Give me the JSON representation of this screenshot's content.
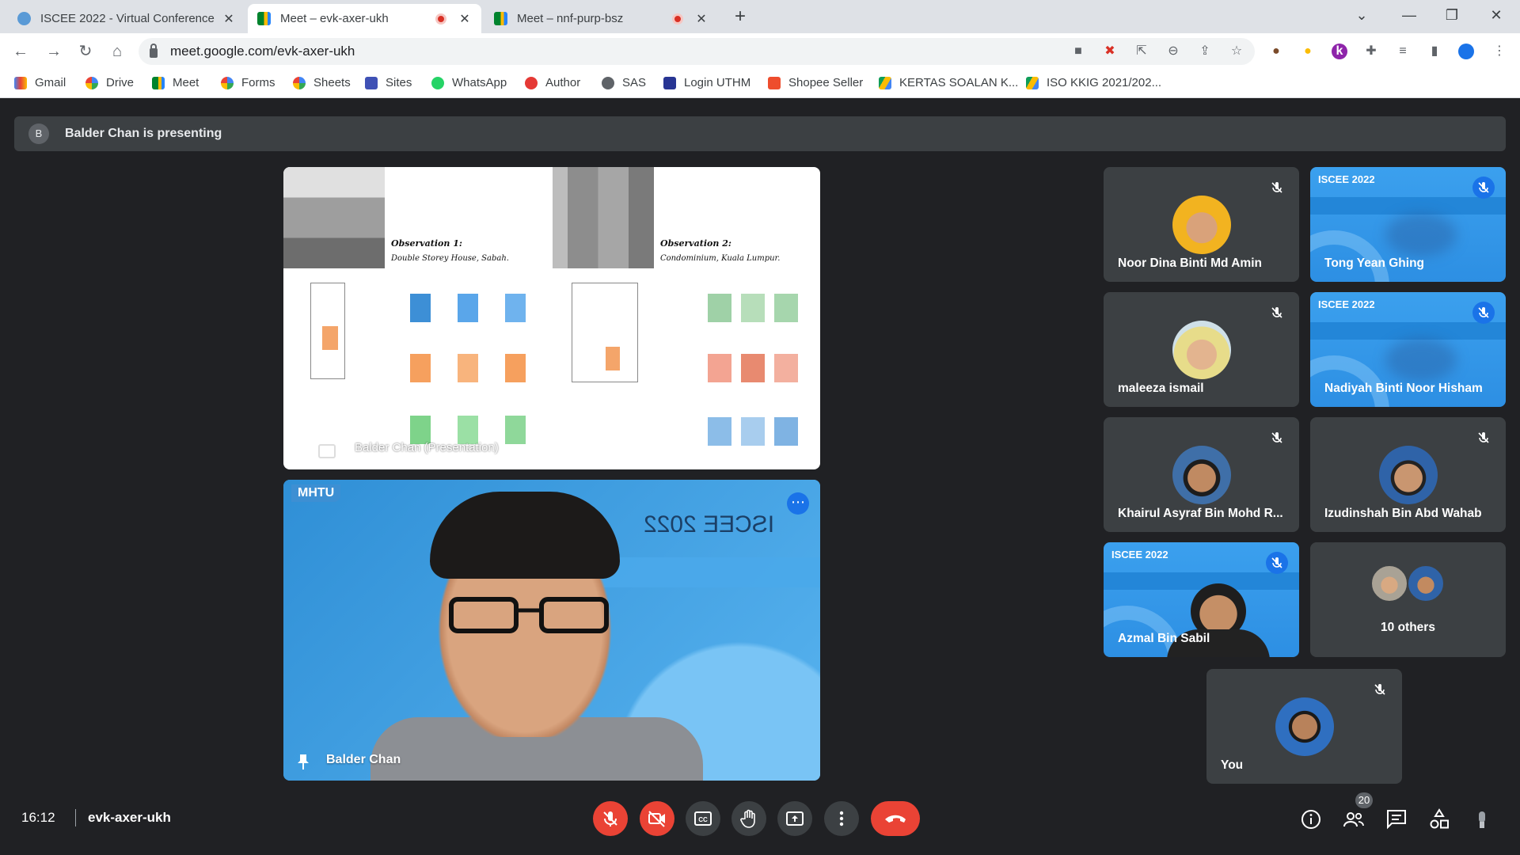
{
  "browser": {
    "tabs": [
      {
        "title": "ISCEE 2022 - Virtual Conference",
        "active": false
      },
      {
        "title": "Meet – evk-axer-ukh",
        "active": true,
        "recording": true
      },
      {
        "title": "Meet – nnf-purp-bsz",
        "active": false,
        "recording": true
      }
    ],
    "url": "meet.google.com/evk-axer-ukh",
    "bookmarks": [
      {
        "label": "Gmail",
        "icon": "gmail-icon"
      },
      {
        "label": "Drive",
        "icon": "google-icon"
      },
      {
        "label": "Meet",
        "icon": "meet-icon"
      },
      {
        "label": "Forms",
        "icon": "google-icon"
      },
      {
        "label": "Sheets",
        "icon": "google-icon"
      },
      {
        "label": "Sites",
        "icon": "sites-icon"
      },
      {
        "label": "WhatsApp",
        "icon": "whatsapp-icon"
      },
      {
        "label": "Author",
        "icon": "author-icon"
      },
      {
        "label": "SAS",
        "icon": "globe-icon"
      },
      {
        "label": "Login UTHM",
        "icon": "shield-icon"
      },
      {
        "label": "Shopee Seller",
        "icon": "shopee-icon"
      },
      {
        "label": "KERTAS SOALAN K...",
        "icon": "drive-icon"
      },
      {
        "label": "ISO KKIG 2021/202...",
        "icon": "drive-icon"
      }
    ]
  },
  "meet": {
    "presenting_banner": {
      "avatar_letter": "B",
      "text": "Balder Chan is presenting"
    },
    "presentation": {
      "label": "Balder Chan (Presentation)",
      "observation1_title": "Observation 1:",
      "observation1_sub": "Double Storey House, Sabah.",
      "observation2_title": "Observation 2:",
      "observation2_sub": "Condominium, Kuala Lumpur."
    },
    "speaker": {
      "name": "Balder Chan",
      "logo": "MHTU",
      "banner": "ISCEE 2022"
    },
    "participants": [
      {
        "name": "Noor Dina Binti Md Amin",
        "muted": true,
        "style": "avatar"
      },
      {
        "name": "Tong Yean Ghing",
        "muted": true,
        "style": "video"
      },
      {
        "name": "maleeza ismail",
        "muted": true,
        "style": "avatar"
      },
      {
        "name": "Nadiyah Binti Noor Hisham",
        "muted": true,
        "style": "video"
      },
      {
        "name": "Khairul Asyraf Bin Mohd R...",
        "muted": true,
        "style": "avatar"
      },
      {
        "name": "Izudinshah Bin Abd Wahab",
        "muted": true,
        "style": "avatar"
      },
      {
        "name": "Azmal Bin Sabil",
        "muted": true,
        "style": "video"
      },
      {
        "name": "10 others",
        "muted": false,
        "style": "others"
      },
      {
        "name": "You",
        "muted": true,
        "style": "avatar"
      }
    ],
    "bottom": {
      "time": "16:12",
      "meeting_code": "evk-axer-ukh",
      "participant_count": "20"
    },
    "colors": {
      "hangup": "#ea4335",
      "accent": "#1a73e8",
      "background": "#202124",
      "tile": "#3c4043"
    }
  }
}
